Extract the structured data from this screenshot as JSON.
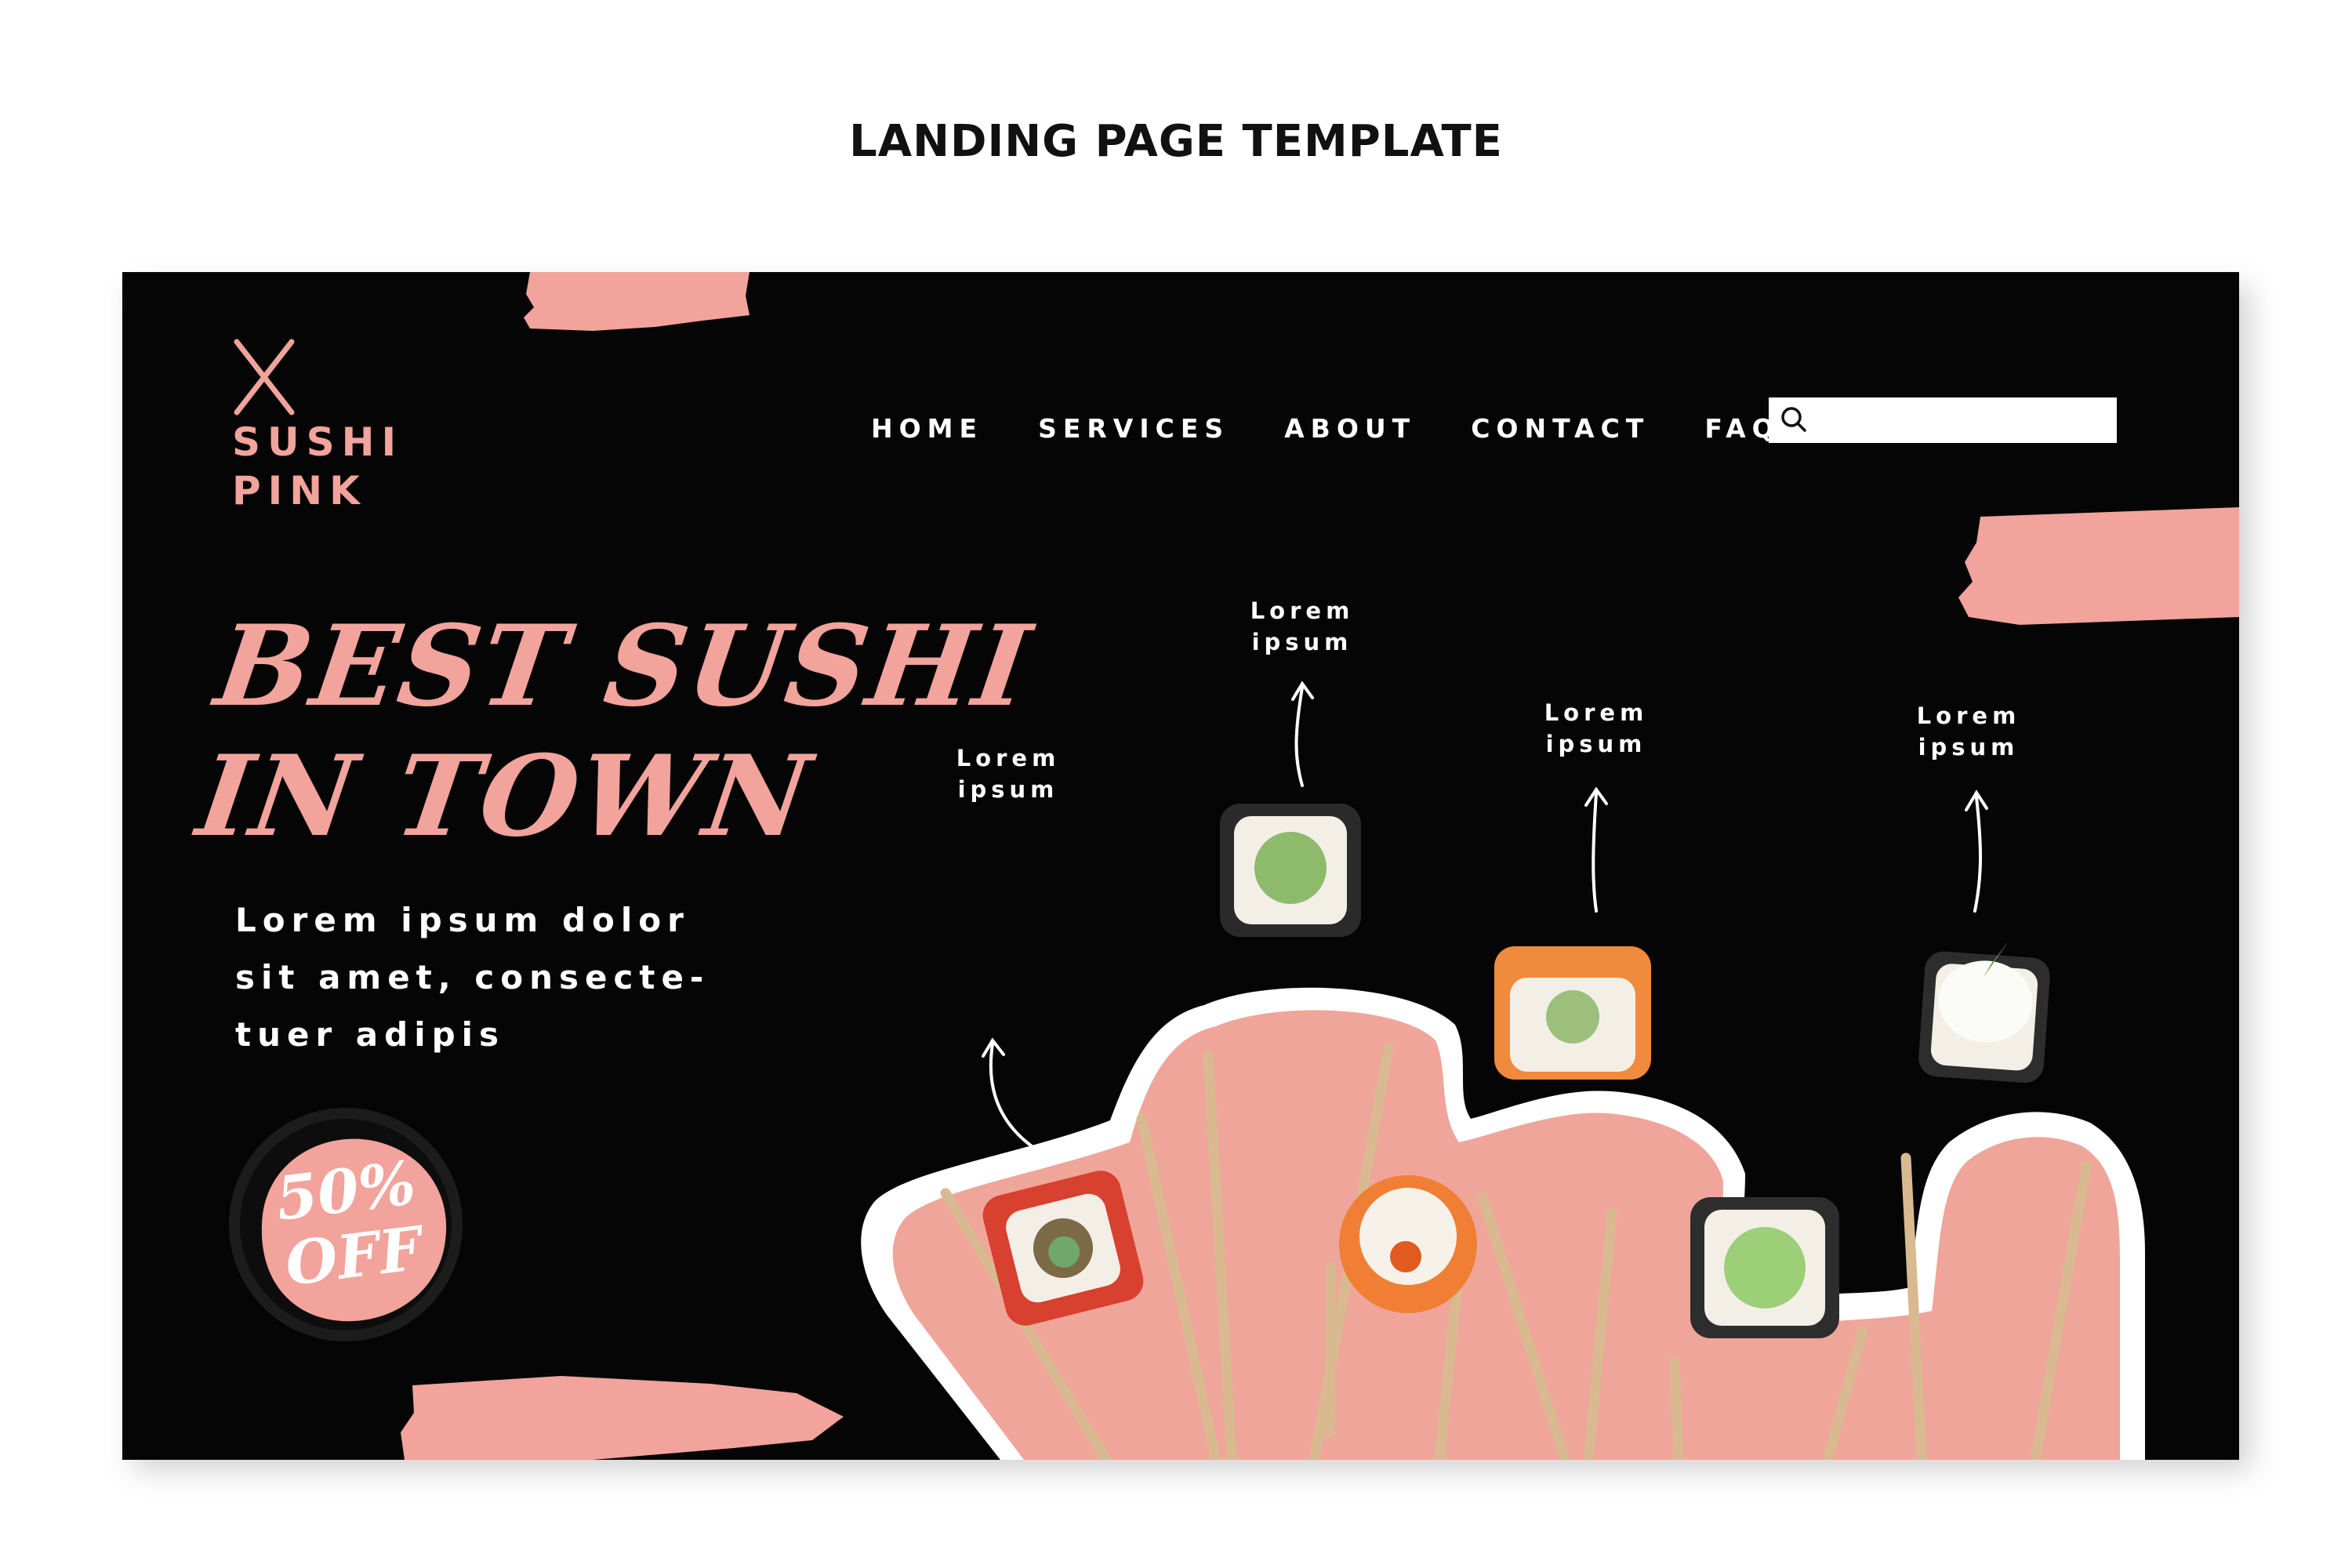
{
  "page": {
    "title": "LANDING PAGE TEMPLATE"
  },
  "colors": {
    "pink": "#f1a39c",
    "background": "#050505",
    "text": "#ffffff"
  },
  "logo": {
    "icon": "chopsticks-x-icon",
    "line1": "SUSHI",
    "line2": "PINK"
  },
  "nav": {
    "items": [
      "HOME",
      "SERVICES",
      "ABOUT",
      "CONTACT",
      "FAQ"
    ]
  },
  "search": {
    "icon": "search-icon",
    "placeholder": ""
  },
  "hero": {
    "headline_line1": "BEST SUSHI",
    "headline_line2": "IN TOWN",
    "lead_line1": "Lorem ipsum dolor",
    "lead_line2": "sit amet, consecte-",
    "lead_line3": "tuer adipis"
  },
  "badge": {
    "line1": "50%",
    "line2": "OFF"
  },
  "callouts": [
    {
      "line1": "Lorem",
      "line2": "ipsum"
    },
    {
      "line1": "Lorem",
      "line2": "ipsum"
    },
    {
      "line1": "Lorem",
      "line2": "ipsum"
    },
    {
      "line1": "Lorem",
      "line2": "ipsum"
    }
  ]
}
